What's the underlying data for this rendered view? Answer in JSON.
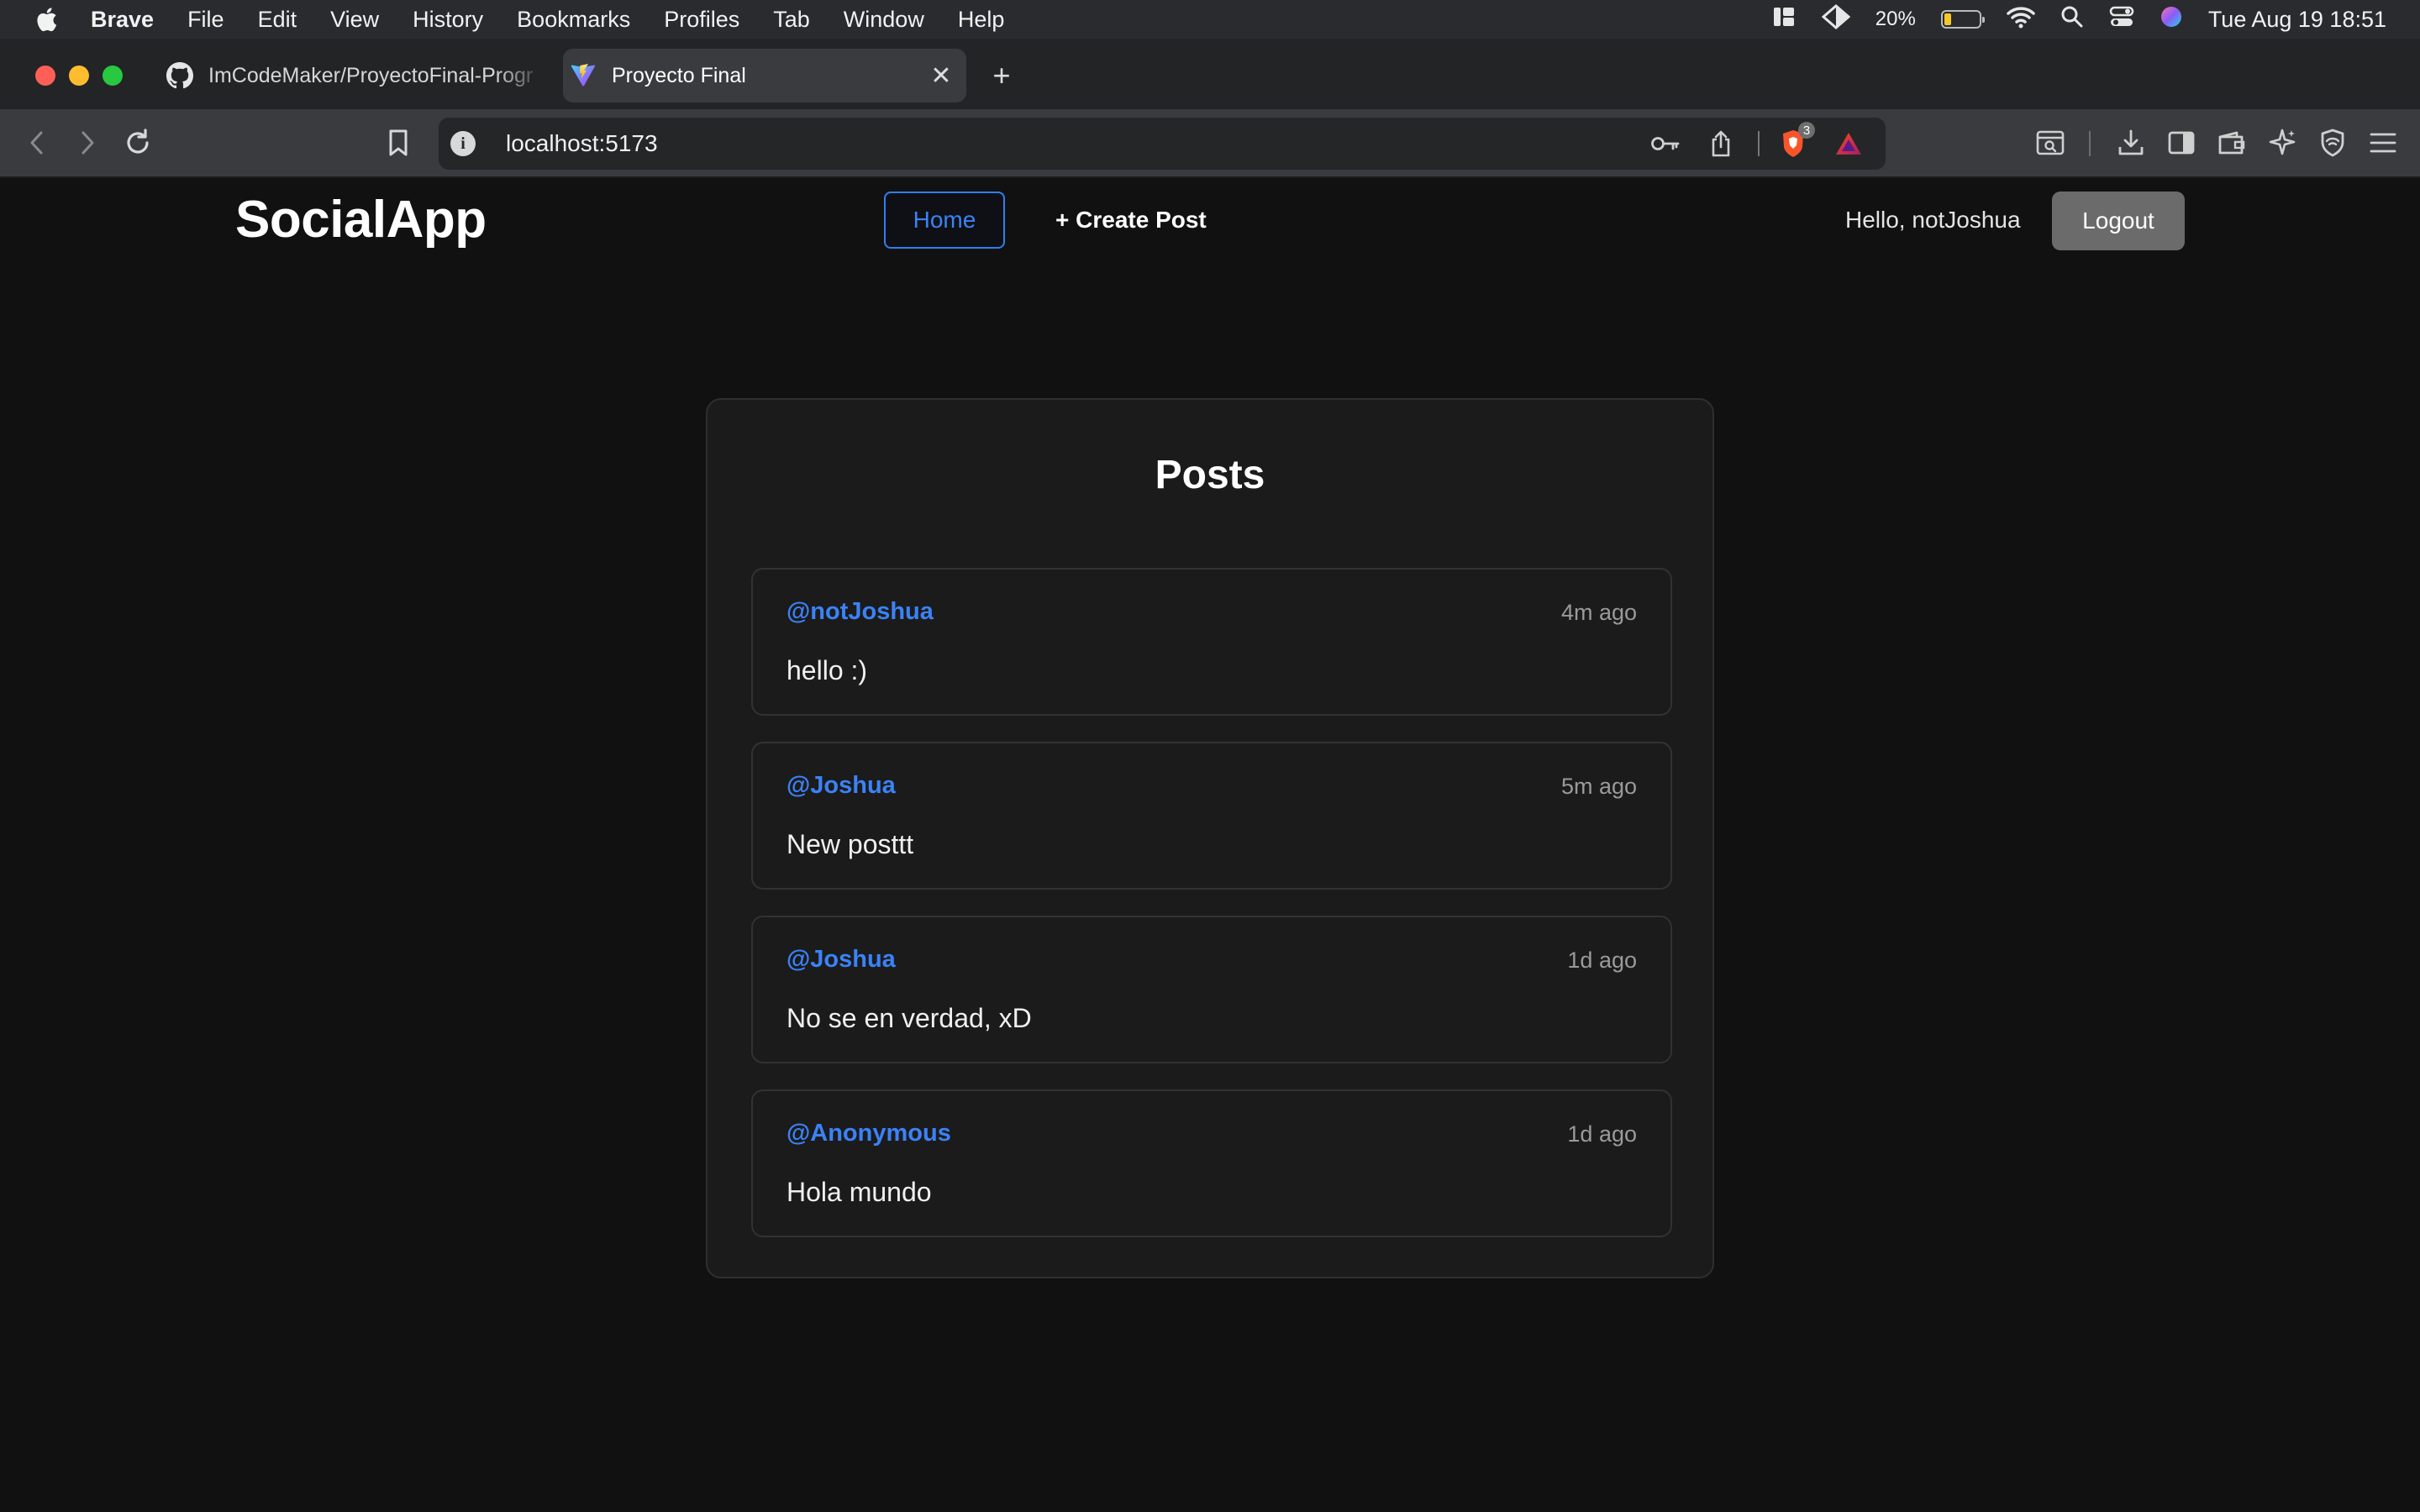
{
  "menubar": {
    "app_name": "Brave",
    "items": [
      "File",
      "Edit",
      "View",
      "History",
      "Bookmarks",
      "Profiles",
      "Tab",
      "Window",
      "Help"
    ],
    "battery_percent": "20%",
    "battery_level": 0.2,
    "datetime": "Tue Aug 19  18:51"
  },
  "browser": {
    "tabs": [
      {
        "title": "ImCodeMaker/ProyectoFinal-Progr",
        "icon": "github-icon",
        "active": false
      },
      {
        "title": "Proyecto Final",
        "icon": "vite-icon",
        "active": true
      }
    ],
    "url": "localhost:5173",
    "shields_count": "3"
  },
  "app": {
    "logo": "SocialApp",
    "nav": {
      "home": "Home",
      "create_post": "+ Create Post"
    },
    "greeting": "Hello, notJoshua",
    "logout": "Logout",
    "posts_title": "Posts",
    "posts": [
      {
        "author": "@notJoshua",
        "time": "4m ago",
        "content": "hello :)"
      },
      {
        "author": "@Joshua",
        "time": "5m ago",
        "content": "New posttt"
      },
      {
        "author": "@Joshua",
        "time": "1d ago",
        "content": "No se en verdad, xD"
      },
      {
        "author": "@Anonymous",
        "time": "1d ago",
        "content": "Hola mundo"
      }
    ]
  },
  "colors": {
    "accent": "#3b82f6",
    "page_bg": "#111111",
    "panel_bg": "#1b1b1c",
    "logout_bg": "#6b6b6b"
  }
}
